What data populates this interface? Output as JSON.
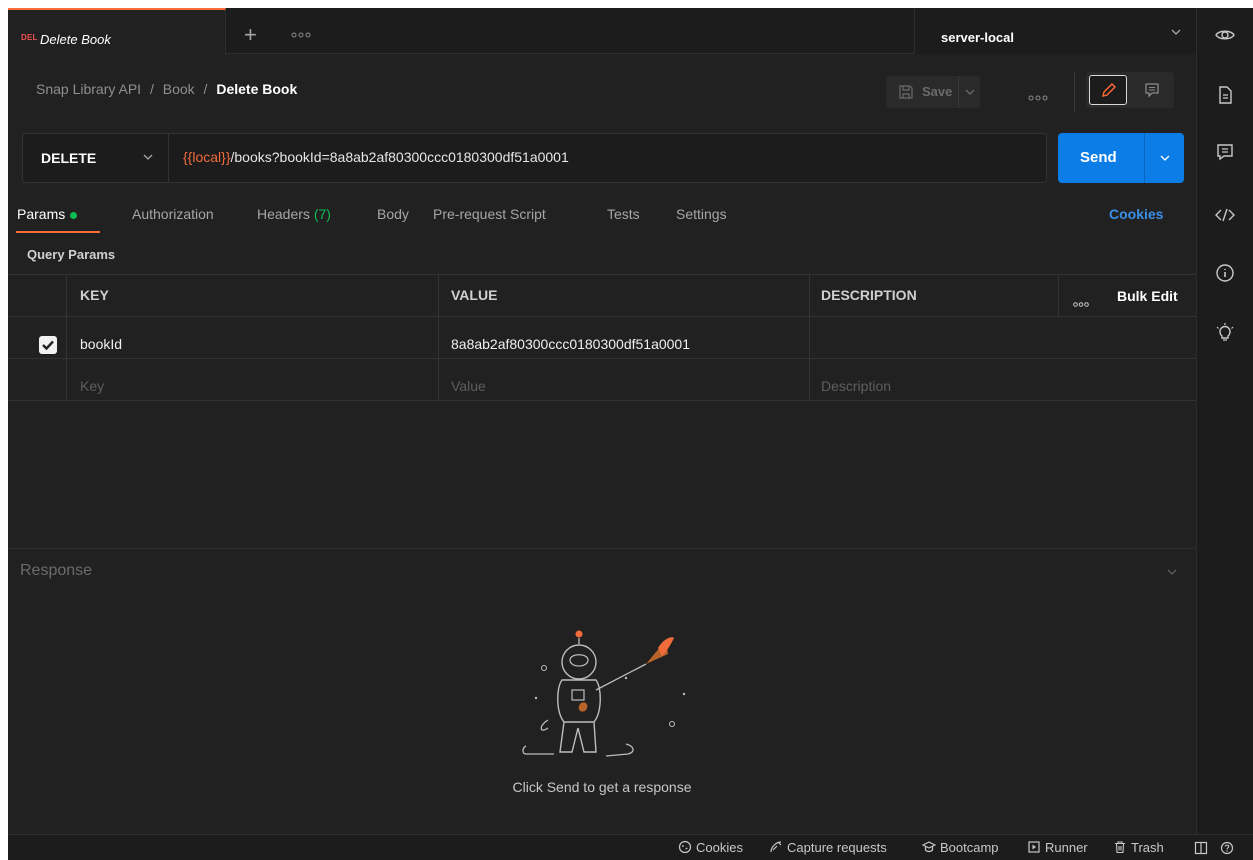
{
  "tab": {
    "method_badge": "DEL",
    "title": "Delete Book",
    "new_tab": "+"
  },
  "environment": {
    "name": "server-local"
  },
  "breadcrumb": {
    "collection": "Snap Library API",
    "sep": "/",
    "folder": "Book",
    "current": "Delete Book"
  },
  "toolbar": {
    "save_label": "Save"
  },
  "request": {
    "method": "DELETE",
    "url_variable": "{{local}}",
    "url_rest": "/books?bookId=8a8ab2af80300ccc0180300df51a0001",
    "send_label": "Send"
  },
  "request_tabs": {
    "params": "Params",
    "authorization": "Authorization",
    "headers": "Headers",
    "headers_count": "(7)",
    "body": "Body",
    "prerequest": "Pre-request Script",
    "tests": "Tests",
    "settings": "Settings",
    "cookies": "Cookies"
  },
  "query_params": {
    "title": "Query Params",
    "headers": {
      "key": "KEY",
      "value": "VALUE",
      "description": "DESCRIPTION",
      "bulk_edit": "Bulk Edit"
    },
    "rows": [
      {
        "checked": true,
        "key": "bookId",
        "value": "8a8ab2af80300ccc0180300df51a0001",
        "description": ""
      }
    ],
    "placeholders": {
      "key": "Key",
      "value": "Value",
      "description": "Description"
    }
  },
  "response": {
    "title": "Response",
    "empty_message": "Click Send to get a response"
  },
  "statusbar": {
    "cookies": "Cookies",
    "capture": "Capture requests",
    "bootcamp": "Bootcamp",
    "runner": "Runner",
    "trash": "Trash"
  },
  "colors": {
    "background": "#212121",
    "accent": "#ff6c37",
    "send_blue": "#0c7ce6",
    "method_delete": "#f05050",
    "success_green": "#0cbb52",
    "link_blue": "#3a8fe8"
  }
}
